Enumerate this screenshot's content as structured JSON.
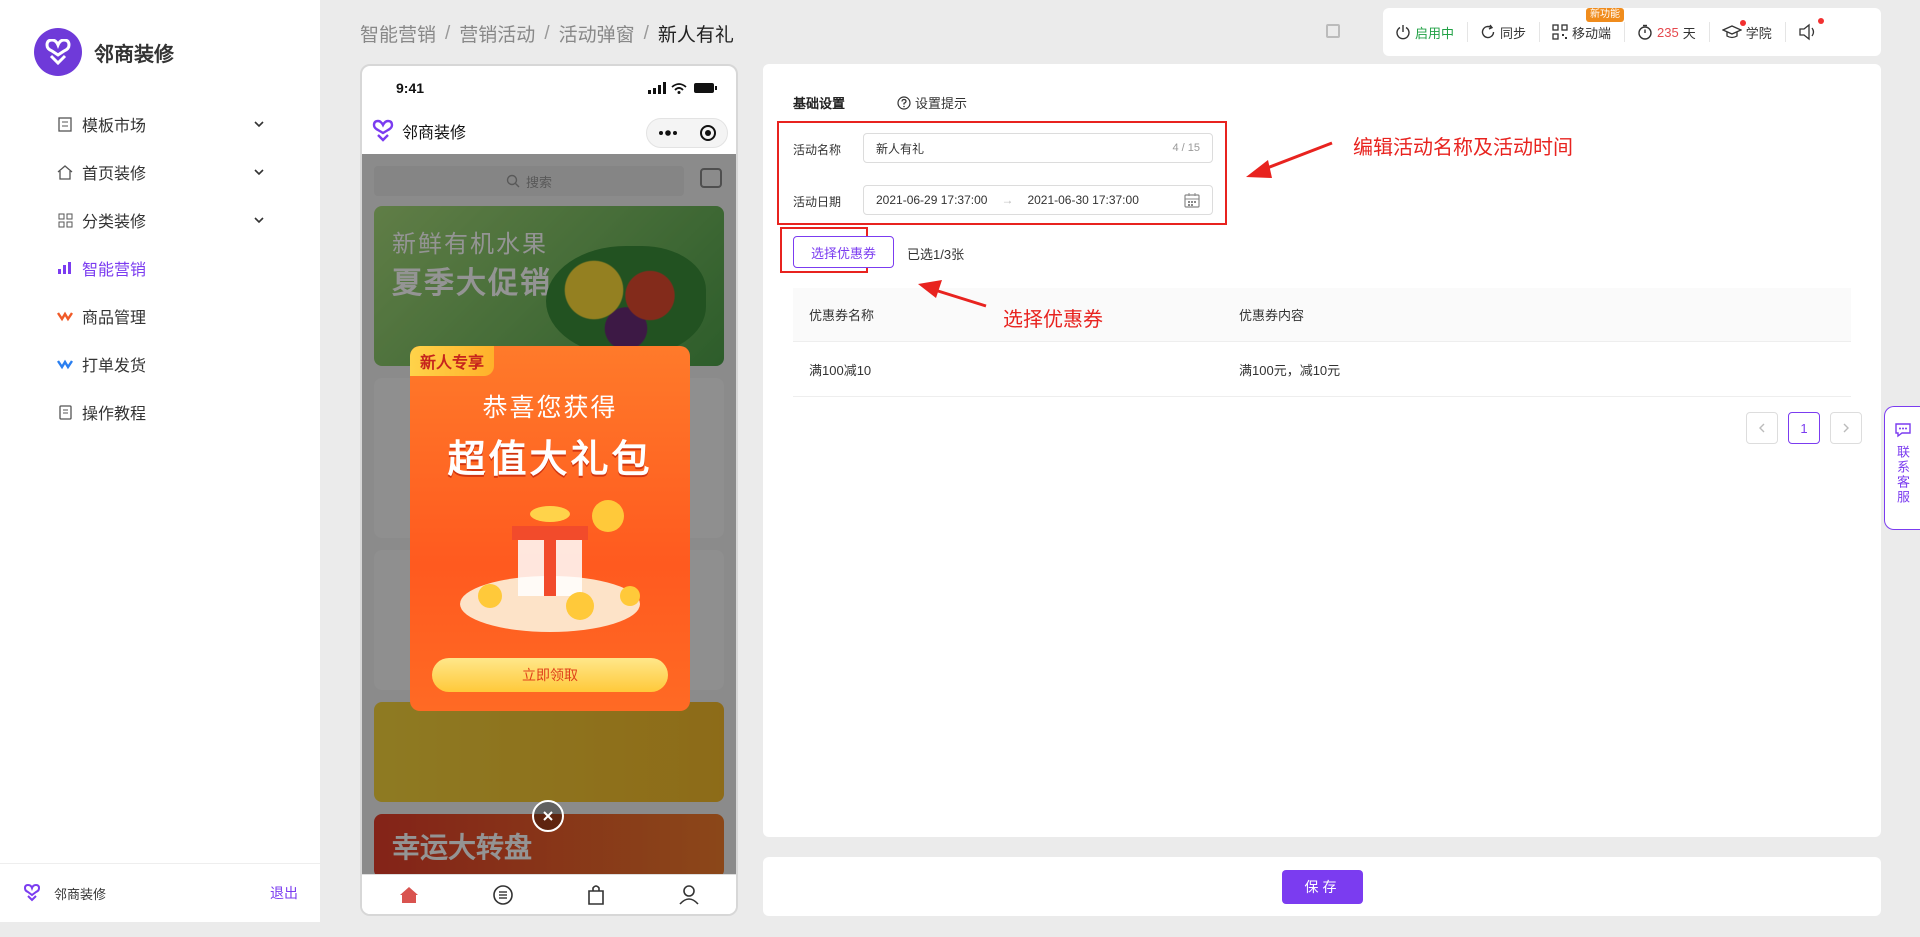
{
  "app": {
    "name": "邻商装修"
  },
  "sidebar": {
    "items": [
      {
        "label": "模板市场",
        "icon": "template-icon"
      },
      {
        "label": "首页装修",
        "icon": "home-icon"
      },
      {
        "label": "分类装修",
        "icon": "category-icon"
      },
      {
        "label": "智能营销",
        "icon": "marketing-icon"
      },
      {
        "label": "商品管理",
        "icon": "goods-icon"
      },
      {
        "label": "打单发货",
        "icon": "shipping-icon"
      },
      {
        "label": "操作教程",
        "icon": "tutorial-icon"
      }
    ],
    "footer": {
      "name": "邻商装修",
      "logout": "退出"
    }
  },
  "breadcrumb": [
    "智能营销",
    "营销活动",
    "活动弹窗",
    "新人有礼"
  ],
  "toolbar": {
    "status": "启用中",
    "sync": "同步",
    "mobile": "移动端",
    "new_badge": "新功能",
    "days_value": "235",
    "days_unit": "天",
    "academy": "学院"
  },
  "phone": {
    "time": "9:41",
    "shop_name": "邻商装修",
    "search_placeholder": "搜索",
    "banner_line1": "新鲜有机水果",
    "banner_line2": "夏季大促销",
    "lucky": "幸运大转盘",
    "popup": {
      "tag": "新人专享",
      "line1": "恭喜您获得",
      "line2": "超值大礼包",
      "button": "立即领取"
    }
  },
  "settings": {
    "tab_basic": "基础设置",
    "tab_hint": "设置提示",
    "name_label": "活动名称",
    "name_value": "新人有礼",
    "name_count": "4 / 15",
    "date_label": "活动日期",
    "date_start": "2021-06-29 17:37:00",
    "date_end": "2021-06-30 17:37:00",
    "select_button": "选择优惠券",
    "selected_count": "已选1/3张",
    "table": {
      "headers": [
        "优惠券名称",
        "优惠券内容"
      ],
      "rows": [
        [
          "满100减10",
          "满100元，减10元"
        ]
      ]
    },
    "pagination": {
      "current": "1"
    }
  },
  "annotations": {
    "edit": "编辑活动名称及活动时间",
    "select": "选择优惠券"
  },
  "save_button": "保存",
  "contact": "联系客服",
  "colors": {
    "accent": "#7b3cf0",
    "annotation": "#e8231f",
    "status_green": "#21a145"
  }
}
